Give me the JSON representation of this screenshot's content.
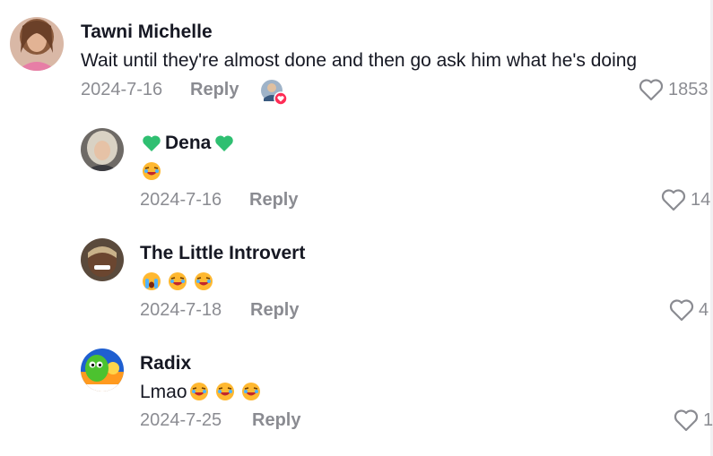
{
  "comment": {
    "author": "Tawni Michelle",
    "text": "Wait until they're almost done and then go ask him what he's doing",
    "date": "2024-7-16",
    "reply_label": "Reply",
    "likes": "1853",
    "badge_icon": "creator-liked-badge"
  },
  "replies": [
    {
      "author": "Dena",
      "author_decoration_icon": "green-heart-icon",
      "emojis": [
        "laughing-emoji"
      ],
      "date": "2024-7-16",
      "reply_label": "Reply",
      "likes": "14"
    },
    {
      "author": "The Little Introvert",
      "emojis": [
        "crying-emoji",
        "laughing-emoji",
        "laughing-emoji"
      ],
      "date": "2024-7-18",
      "reply_label": "Reply",
      "likes": "4"
    },
    {
      "author": "Radix",
      "text": "Lmao",
      "emojis": [
        "laughing-emoji",
        "laughing-emoji",
        "laughing-emoji"
      ],
      "date": "2024-7-25",
      "reply_label": "Reply",
      "likes": "1"
    }
  ],
  "colors": {
    "text": "#161823",
    "muted": "rgba(22,24,35,0.5)",
    "heart_green": "#25c47a",
    "badge_red": "#fe2c55"
  }
}
